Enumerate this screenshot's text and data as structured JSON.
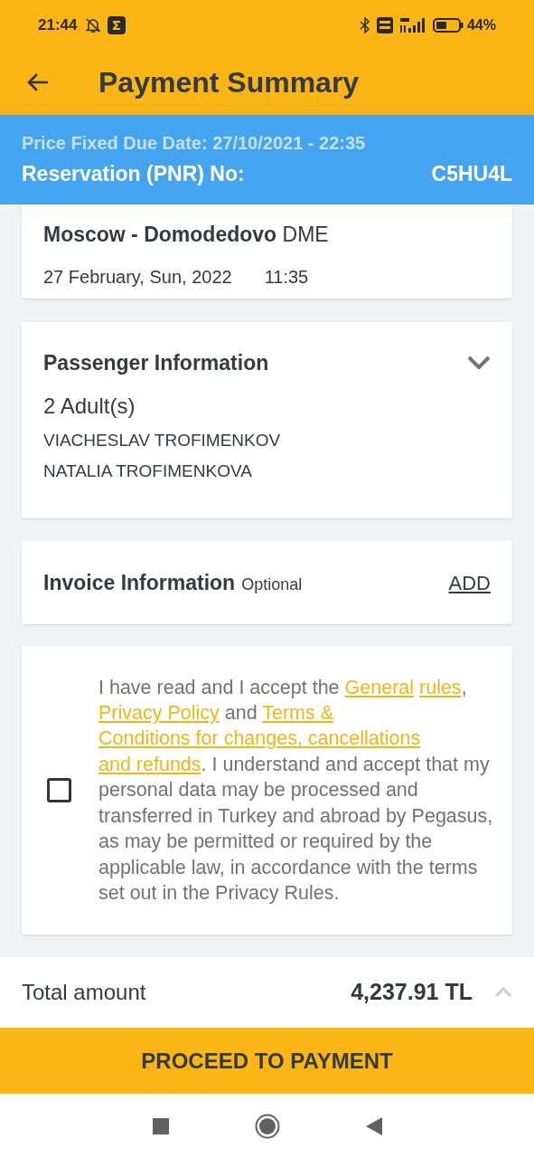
{
  "status_bar": {
    "time": "21:44",
    "battery": "44%"
  },
  "app_bar": {
    "title": "Payment Summary"
  },
  "banner": {
    "due_date": "Price Fixed Due Date: 27/10/2021 - 22:35",
    "pnr_label": "Reservation (PNR) No:",
    "pnr_value": "C5HU4L"
  },
  "flight": {
    "arrival": "**Moscow - Domodedovo** DME",
    "date": "27 February, Sun, 2022",
    "time": "11:35"
  },
  "passengers": {
    "title": "Passenger Information",
    "expanded": false,
    "count": "2 Adult(s)",
    "names": [
      "VIACHESLAV TROFIMENKOV",
      "NATALIA TROFIMENKOVA"
    ]
  },
  "invoice": {
    "title": "Invoice Information",
    "note": "Optional",
    "action": "ADD"
  },
  "consent": {
    "checked": false,
    "parts": [
      {
        "kind": "text",
        "text": "I have read and I accept the "
      },
      {
        "kind": "link",
        "text": "General"
      },
      {
        "kind": "space"
      },
      {
        "kind": "link",
        "text": "rules"
      },
      {
        "kind": "text",
        "text": ", "
      },
      {
        "kind": "link",
        "text": "Privacy Policy"
      },
      {
        "kind": "text",
        "text": " and "
      },
      {
        "kind": "link",
        "text": "Terms &"
      },
      {
        "kind": "space"
      },
      {
        "kind": "link",
        "text": "Conditions for changes, cancellations"
      },
      {
        "kind": "space"
      },
      {
        "kind": "link",
        "text": "and refunds"
      },
      {
        "kind": "text",
        "text": ". I understand and accept that my personal data may be processed and transferred in Turkey and abroad by Pegasus, as may be permitted or required by the applicable law, in accordance with the terms set out in the Privacy Rules."
      }
    ]
  },
  "total": {
    "label": "Total amount",
    "value": "4,237.91 TL",
    "expanded": false
  },
  "proceed_button": "PROCEED TO PAYMENT"
}
